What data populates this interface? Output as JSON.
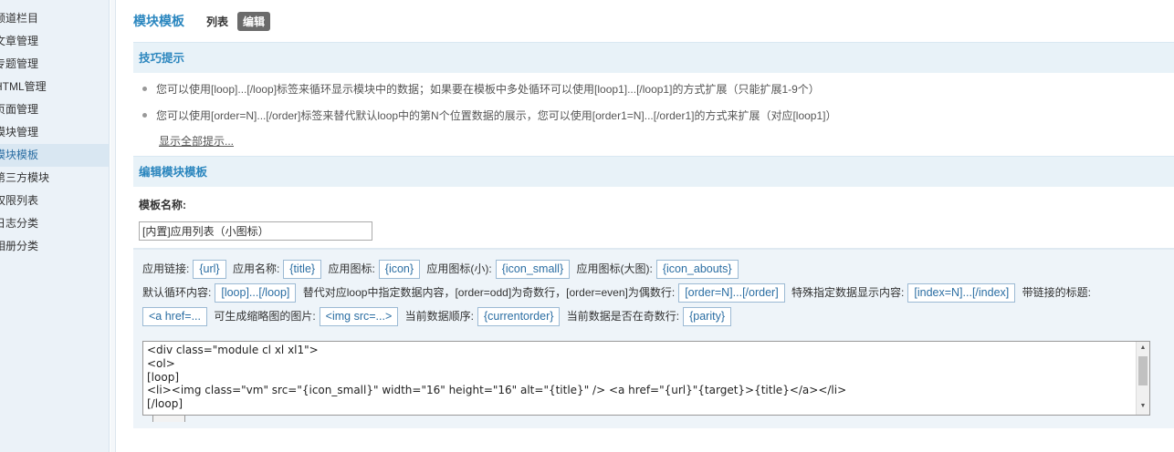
{
  "sidebar": {
    "items": [
      {
        "label": "频道栏目"
      },
      {
        "label": "文章管理"
      },
      {
        "label": "专题管理"
      },
      {
        "label": "HTML管理"
      },
      {
        "label": "页面管理"
      },
      {
        "label": "模块管理"
      },
      {
        "label": "模块模板"
      },
      {
        "label": "第三方模块"
      },
      {
        "label": "权限列表"
      },
      {
        "label": "日志分类"
      },
      {
        "label": "相册分类"
      }
    ],
    "active_index": 6
  },
  "header": {
    "title": "模块模板",
    "tabs": [
      {
        "label": "列表"
      },
      {
        "label": "编辑"
      }
    ]
  },
  "tips": {
    "title": "技巧提示",
    "items": [
      {
        "text": "您可以使用[loop]...[/loop]标签来循环显示模块中的数据；如果要在模板中多处循环可以使用[loop1]...[/loop1]的方式扩展（只能扩展1-9个）"
      },
      {
        "text": "您可以使用[order=N]...[/order]标签来替代默认loop中的第N个位置数据的展示，您可以使用[order1=N]...[/order1]的方式来扩展（对应[loop1]）"
      }
    ],
    "show_all": "显示全部提示..."
  },
  "edit": {
    "title": "编辑模块模板",
    "name_label": "模板名称:",
    "name_value": "[内置]应用列表（小图标）"
  },
  "vars": {
    "row1": [
      {
        "label": "应用链接:",
        "tag": "{url}"
      },
      {
        "label": "应用名称:",
        "tag": "{title}"
      },
      {
        "label": "应用图标:",
        "tag": "{icon}"
      },
      {
        "label": "应用图标(小):",
        "tag": "{icon_small}"
      },
      {
        "label": "应用图标(大图):",
        "tag": "{icon_abouts}"
      }
    ],
    "row2": [
      {
        "label": "默认循环内容:",
        "tag": "[loop]...[/loop]"
      },
      {
        "label": "替代对应loop中指定数据内容，[order=odd]为奇数行，[order=even]为偶数行:",
        "tag": "[order=N]...[/order]"
      },
      {
        "label": "特殊指定数据显示内容:",
        "tag": "[index=N]...[/index]"
      },
      {
        "label": "带链接的标题:",
        "tag": ""
      }
    ],
    "row3": [
      {
        "label": "",
        "tag": "<a href=..."
      },
      {
        "label": "可生成缩略图的图片:",
        "tag": "<img src=...>"
      },
      {
        "label": "当前数据顺序:",
        "tag": "{currentorder}"
      },
      {
        "label": "当前数据是否在奇数行:",
        "tag": "{parity}"
      }
    ]
  },
  "editor": {
    "lines": [
      "<div class=\"module cl xl xl1\">",
      "<ol>",
      "[loop]",
      "<li><img class=\"vm\" src=\"{icon_small}\" width=\"16\" height=\"16\" alt=\"{title}\" /> <a href=\"{url}\"{target}>{title}</a></li>",
      "[/loop]"
    ]
  },
  "colors": {
    "accent": "#2a86bf",
    "section_bg": "#e8f2f8",
    "tag_border": "#9cbad4"
  }
}
